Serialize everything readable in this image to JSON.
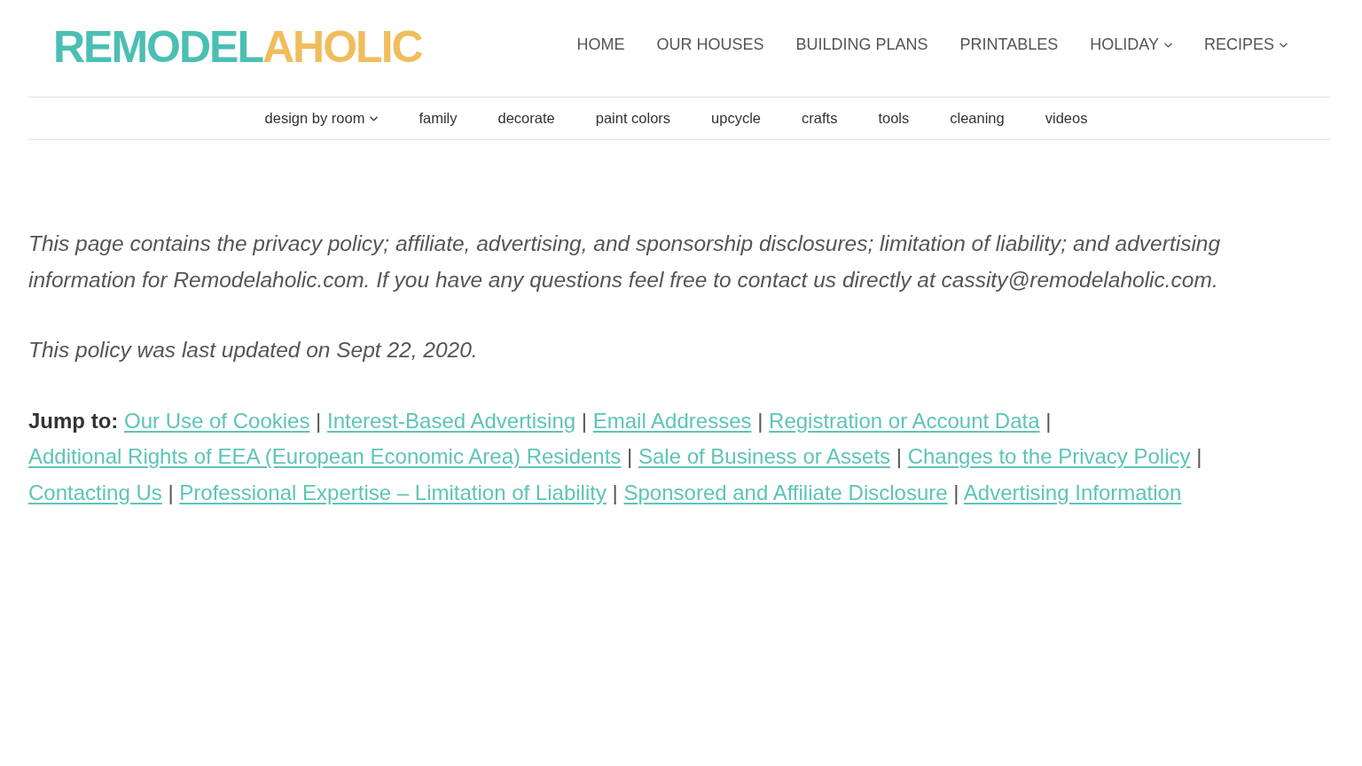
{
  "logo": {
    "text": "REMODEL",
    "accent_text": "AHOLIC"
  },
  "main_nav": [
    {
      "label": "HOME",
      "dropdown": false
    },
    {
      "label": "OUR HOUSES",
      "dropdown": false
    },
    {
      "label": "BUILDING PLANS",
      "dropdown": false
    },
    {
      "label": "PRINTABLES",
      "dropdown": false
    },
    {
      "label": "HOLIDAY",
      "dropdown": true
    },
    {
      "label": "RECIPES",
      "dropdown": true
    }
  ],
  "sub_nav": [
    {
      "label": "design by room",
      "dropdown": true
    },
    {
      "label": "family",
      "dropdown": false
    },
    {
      "label": "decorate",
      "dropdown": false
    },
    {
      "label": "paint colors",
      "dropdown": false
    },
    {
      "label": "upcycle",
      "dropdown": false
    },
    {
      "label": "crafts",
      "dropdown": false
    },
    {
      "label": "tools",
      "dropdown": false
    },
    {
      "label": "cleaning",
      "dropdown": false
    },
    {
      "label": "videos",
      "dropdown": false
    }
  ],
  "intro": [
    "This page contains the privacy policy; affiliate, advertising, and sponsorship disclosures; limitation of liability; and advertising information for Remodelaholic.com. If you have any questions feel free to contact us directly at cassity@remodelaholic.com.",
    "This policy was last updated on Sept 22, 2020."
  ],
  "jump_to": {
    "label": "Jump to:",
    "links": [
      {
        "text": "Our Use of Cookies",
        "separator": "|"
      },
      {
        "text": "Interest-Based Advertising",
        "separator": "|"
      },
      {
        "text": "Email Addresses",
        "separator": "|"
      },
      {
        "text": "Registration or Account Data",
        "separator": "|"
      },
      {
        "text": "Additional Rights of EEA (European Economic Area) Residents",
        "separator": "|"
      },
      {
        "text": "Sale of Business or Assets",
        "separator": "|"
      },
      {
        "text": "Changes to the Privacy Policy",
        "separator": "|"
      },
      {
        "text": "Contacting Us",
        "separator": "|"
      },
      {
        "text": "Professional Expertise – Limitation of Liability",
        "separator": "|"
      },
      {
        "text": "Sponsored and Affiliate Disclosure",
        "separator": "|"
      },
      {
        "text": "Advertising Information"
      }
    ]
  }
}
